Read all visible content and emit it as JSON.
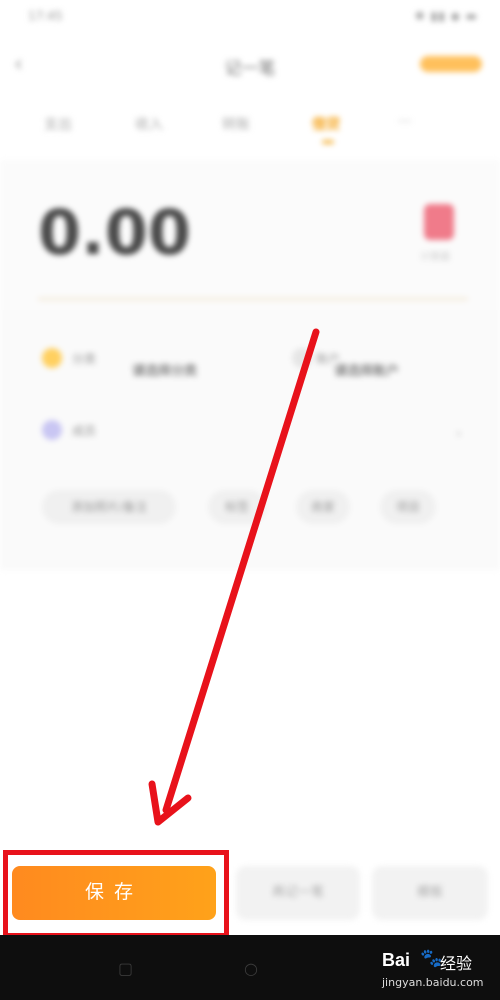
{
  "status_bar": {
    "time": "17:45",
    "icons": "✱ ▮▮ ◆ ▬"
  },
  "header": {
    "back_icon": "‹",
    "title": "记一笔"
  },
  "tabs": [
    {
      "label": "支出"
    },
    {
      "label": "收入"
    },
    {
      "label": "转账"
    },
    {
      "label": "借贷"
    },
    {
      "label": "···"
    }
  ],
  "amount": {
    "value": "0.00",
    "caption": "计算器"
  },
  "fields": {
    "category_label": "分类",
    "category_value": "请选择分类",
    "account_label": "账户",
    "account_value": "请选择账户",
    "member_label": "成员",
    "more_icon": "›"
  },
  "chips": [
    "添加照片/备注",
    "标签",
    "商家",
    "项目"
  ],
  "bottom": {
    "save_label": "保存",
    "secondary_1": "再记一笔",
    "secondary_2": "模板"
  },
  "watermark": {
    "logo": "Bai",
    "paw": "🐾",
    "cn": "经验",
    "domain": "jingyan.baidu.com"
  },
  "colors": {
    "accent": "#ff9a1c",
    "highlight": "#e8121b",
    "arrow": "#e8121b"
  }
}
